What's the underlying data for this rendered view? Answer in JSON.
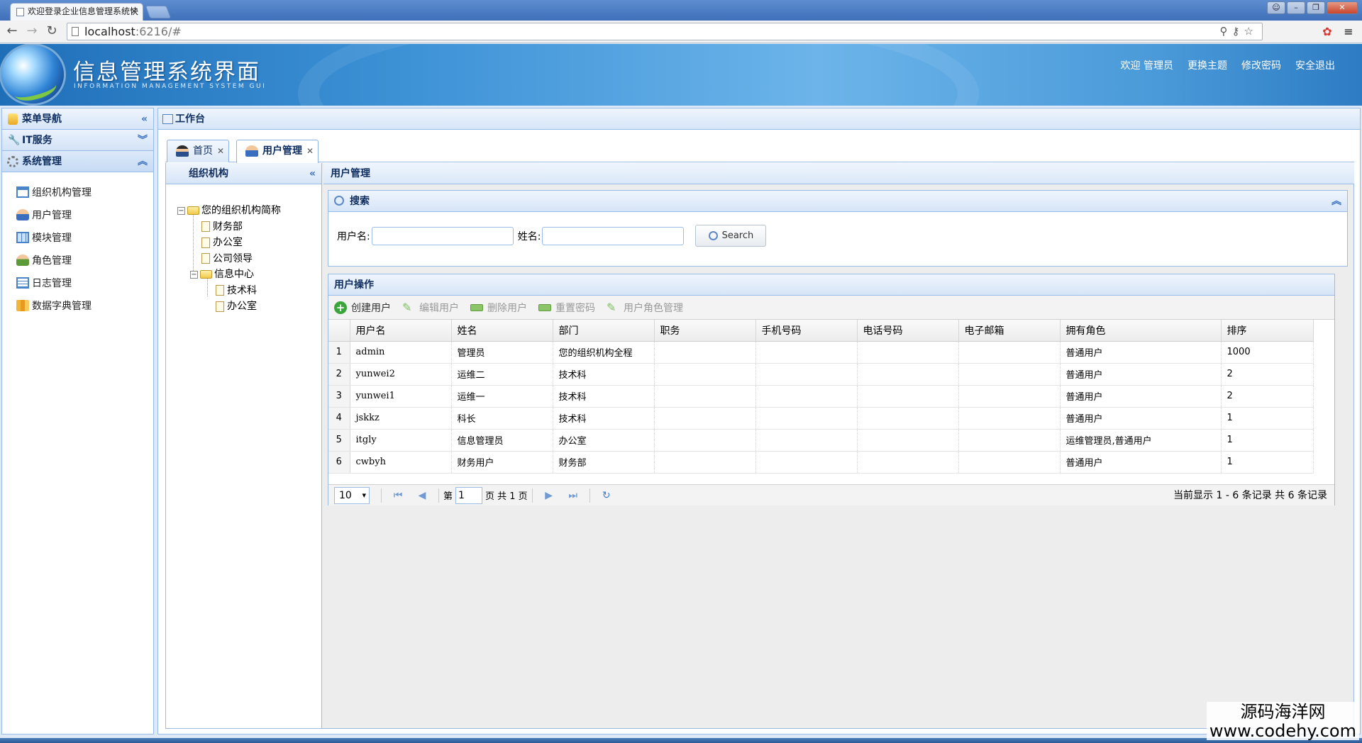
{
  "browser": {
    "tab_title": "欢迎登录企业信息管理系统快",
    "url_host": "localhost",
    "url_path": ":6216/#"
  },
  "header": {
    "title": "信息管理系统界面",
    "subtitle": "INFORMATION MANAGEMENT SYSTEM GUI",
    "links": {
      "welcome": "欢迎 管理员",
      "theme": "更换主题",
      "password": "修改密码",
      "logout": "安全退出"
    }
  },
  "sidebar": {
    "title": "菜单导航",
    "groups": [
      {
        "label": "IT服务"
      },
      {
        "label": "系统管理"
      }
    ],
    "items": [
      {
        "label": "组织机构管理"
      },
      {
        "label": "用户管理"
      },
      {
        "label": "模块管理"
      },
      {
        "label": "角色管理"
      },
      {
        "label": "日志管理"
      },
      {
        "label": "数据字典管理"
      }
    ]
  },
  "workbench": {
    "title": "工作台",
    "tabs": [
      {
        "label": "首页"
      },
      {
        "label": "用户管理"
      }
    ]
  },
  "org": {
    "title": "组织机构",
    "root": "您的组织机构简称",
    "nodes": [
      "财务部",
      "办公室",
      "公司领导",
      "信息中心",
      "技术科",
      "办公室"
    ]
  },
  "user_mgmt": {
    "title": "用户管理",
    "search": {
      "title": "搜索",
      "username_label": "用户名:",
      "name_label": "姓名:",
      "button": "Search"
    },
    "ops": {
      "title": "用户操作",
      "toolbar": [
        "创建用户",
        "编辑用户",
        "删除用户",
        "重置密码",
        "用户角色管理"
      ],
      "columns": [
        "用户名",
        "姓名",
        "部门",
        "职务",
        "手机号码",
        "电话号码",
        "电子邮箱",
        "拥有角色",
        "排序"
      ],
      "rows": [
        {
          "n": "1",
          "cells": [
            "admin",
            "管理员",
            "您的组织机构全程",
            "",
            "",
            "",
            "",
            "普通用户",
            "1000"
          ]
        },
        {
          "n": "2",
          "cells": [
            "yunwei2",
            "运维二",
            "技术科",
            "",
            "",
            "",
            "",
            "普通用户",
            "2"
          ]
        },
        {
          "n": "3",
          "cells": [
            "yunwei1",
            "运维一",
            "技术科",
            "",
            "",
            "",
            "",
            "普通用户",
            "2"
          ]
        },
        {
          "n": "4",
          "cells": [
            "jskkz",
            "科长",
            "技术科",
            "",
            "",
            "",
            "",
            "普通用户",
            "1"
          ]
        },
        {
          "n": "5",
          "cells": [
            "itgly",
            "信息管理员",
            "办公室",
            "",
            "",
            "",
            "",
            "运维管理员,普通用户",
            "1"
          ]
        },
        {
          "n": "6",
          "cells": [
            "cwbyh",
            "财务用户",
            "财务部",
            "",
            "",
            "",
            "",
            "普通用户",
            "1"
          ]
        }
      ],
      "pager": {
        "page_size": "10",
        "page_label_pre": "第",
        "page_value": "1",
        "page_label_post": "页 共 1 页",
        "info": "当前显示 1 - 6 条记录 共 6 条记录"
      }
    }
  },
  "watermark": {
    "line1": "源码海洋网",
    "line2": "www.codehy.com"
  },
  "colors": {
    "accent": "#99bbe8",
    "header": "#3d92d6"
  }
}
